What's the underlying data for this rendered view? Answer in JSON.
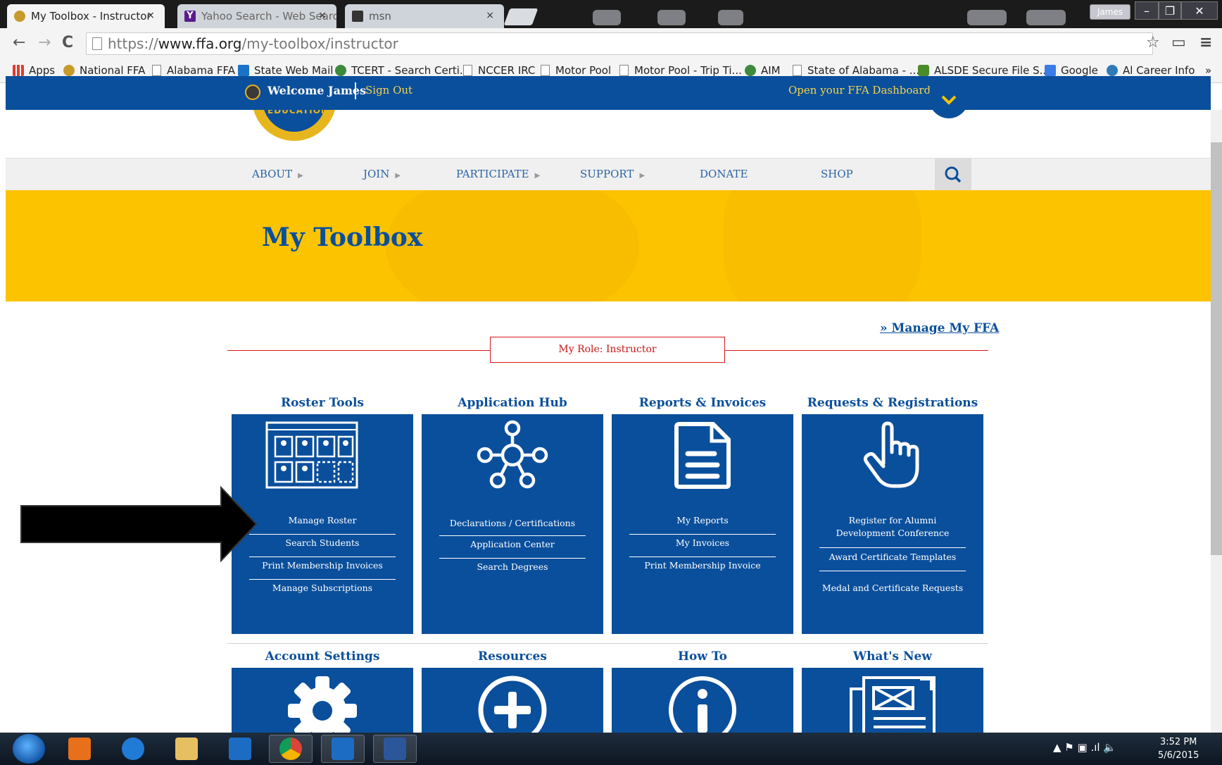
{
  "browser": {
    "tabs": [
      {
        "title": "My Toolbox - Instructor",
        "close": "×",
        "active": true
      },
      {
        "title": "Yahoo Search - Web Searc",
        "close": "×",
        "active": false
      },
      {
        "title": "msn",
        "close": "×",
        "active": false
      }
    ],
    "profile": "James",
    "window_controls": {
      "minimize": "–",
      "restore": "❐",
      "close": "✕"
    },
    "nav": {
      "back": "←",
      "forward": "→",
      "reload": "C"
    },
    "url": {
      "scheme": "https://",
      "host": "www.ffa.org",
      "path": "/my-toolbox/instructor"
    },
    "addr_icons": {
      "star": "☆",
      "cast": "▭",
      "menu": "≡"
    },
    "bookmarks": [
      {
        "label": "Apps",
        "icon": "apps-grid-icon",
        "color": "#e33b2e"
      },
      {
        "label": "National FFA",
        "icon": "ffa-emblem-icon",
        "color": "#c79a2a"
      },
      {
        "label": "Alabama FFA",
        "icon": "page-icon",
        "color": "#ffffff"
      },
      {
        "label": "State Web Mail",
        "icon": "outlook-icon",
        "color": "#1a73c7"
      },
      {
        "label": "TCERT - Search Certi...",
        "icon": "seal-icon",
        "color": "#3c8a3c"
      },
      {
        "label": "NCCER IRC",
        "icon": "page-icon",
        "color": "#ffffff"
      },
      {
        "label": "Motor Pool",
        "icon": "page-icon",
        "color": "#ffffff"
      },
      {
        "label": "Motor Pool - Trip Ti...",
        "icon": "page-icon",
        "color": "#ffffff"
      },
      {
        "label": "AIM",
        "icon": "seal-icon",
        "color": "#3c8a3c"
      },
      {
        "label": "State of Alabama - ...",
        "icon": "page-icon",
        "color": "#ffffff"
      },
      {
        "label": "ALSDE Secure File S...",
        "icon": "cube-icon",
        "color": "#4a8c2a"
      },
      {
        "label": "Google",
        "icon": "google-icon",
        "color": "#3b7de8"
      },
      {
        "label": "Al Career Info",
        "icon": "globe-icon",
        "color": "#2e7bb8"
      }
    ],
    "bookmarks_more": "»"
  },
  "page": {
    "topbar": {
      "welcome": "Welcome James",
      "sign_out": "Sign Out",
      "dashboard": "Open your FFA Dashboard"
    },
    "logo_text": "EDUCATION",
    "nav": [
      {
        "label": "ABOUT",
        "has_arrow": true
      },
      {
        "label": "JOIN",
        "has_arrow": true
      },
      {
        "label": "PARTICIPATE",
        "has_arrow": true
      },
      {
        "label": "SUPPORT",
        "has_arrow": true
      },
      {
        "label": "DONATE",
        "has_arrow": false
      },
      {
        "label": "SHOP",
        "has_arrow": false
      }
    ],
    "nav_arrow": "▶",
    "hero_title": "My Toolbox",
    "manage_link": "» Manage My FFA",
    "role": "My Role: Instructor",
    "sections": [
      {
        "title": "Roster Tools",
        "icon": "roster-icon",
        "links": [
          "Manage Roster",
          "Search Students",
          "Print Membership Invoices",
          "Manage Subscriptions"
        ]
      },
      {
        "title": "Application Hub",
        "icon": "network-hub-icon",
        "links": [
          "Declarations / Certifications",
          "Application Center",
          "Search Degrees"
        ]
      },
      {
        "title": "Reports & Invoices",
        "icon": "document-icon",
        "links": [
          "My Reports",
          "My Invoices",
          "Print Membership Invoice"
        ]
      },
      {
        "title": "Requests & Registrations",
        "icon": "pointing-hand-icon",
        "links": [
          "Register for Alumni Development Conference",
          "Award Certificate Templates",
          "Medal and Certificate Requests"
        ]
      },
      {
        "title": "Account Settings",
        "icon": "gear-icon",
        "links": []
      },
      {
        "title": "Resources",
        "icon": "plus-circle-icon",
        "links": []
      },
      {
        "title": "How To",
        "icon": "info-circle-icon",
        "links": []
      },
      {
        "title": "What's New",
        "icon": "newspaper-icon",
        "links": []
      }
    ],
    "colors": {
      "ffa_blue": "#0a4f9c",
      "ffa_gold": "#fcc300",
      "role_red": "#d81818",
      "link_gold": "#f6d34a"
    }
  },
  "taskbar": {
    "apps": [
      {
        "name": "media-player",
        "icon": "media-player-icon",
        "open": false,
        "color": "#e8701a"
      },
      {
        "name": "internet-explorer",
        "icon": "internet-explorer-icon",
        "open": false,
        "color": "#1f7bd6"
      },
      {
        "name": "file-explorer",
        "icon": "folder-icon",
        "open": false,
        "color": "#e6c060"
      },
      {
        "name": "outlook",
        "icon": "outlook-icon",
        "open": false,
        "color": "#1d6cc4"
      },
      {
        "name": "chrome",
        "icon": "chrome-icon",
        "open": true,
        "color": "#db4437"
      },
      {
        "name": "outlook-window",
        "icon": "outlook-icon",
        "open": true,
        "color": "#1d6cc4"
      },
      {
        "name": "word",
        "icon": "word-icon",
        "open": true,
        "color": "#2b579a"
      }
    ],
    "tray": "▲  ⚑  ▣  .ıl  🔈",
    "time": "3:52 PM",
    "date": "5/6/2015"
  }
}
